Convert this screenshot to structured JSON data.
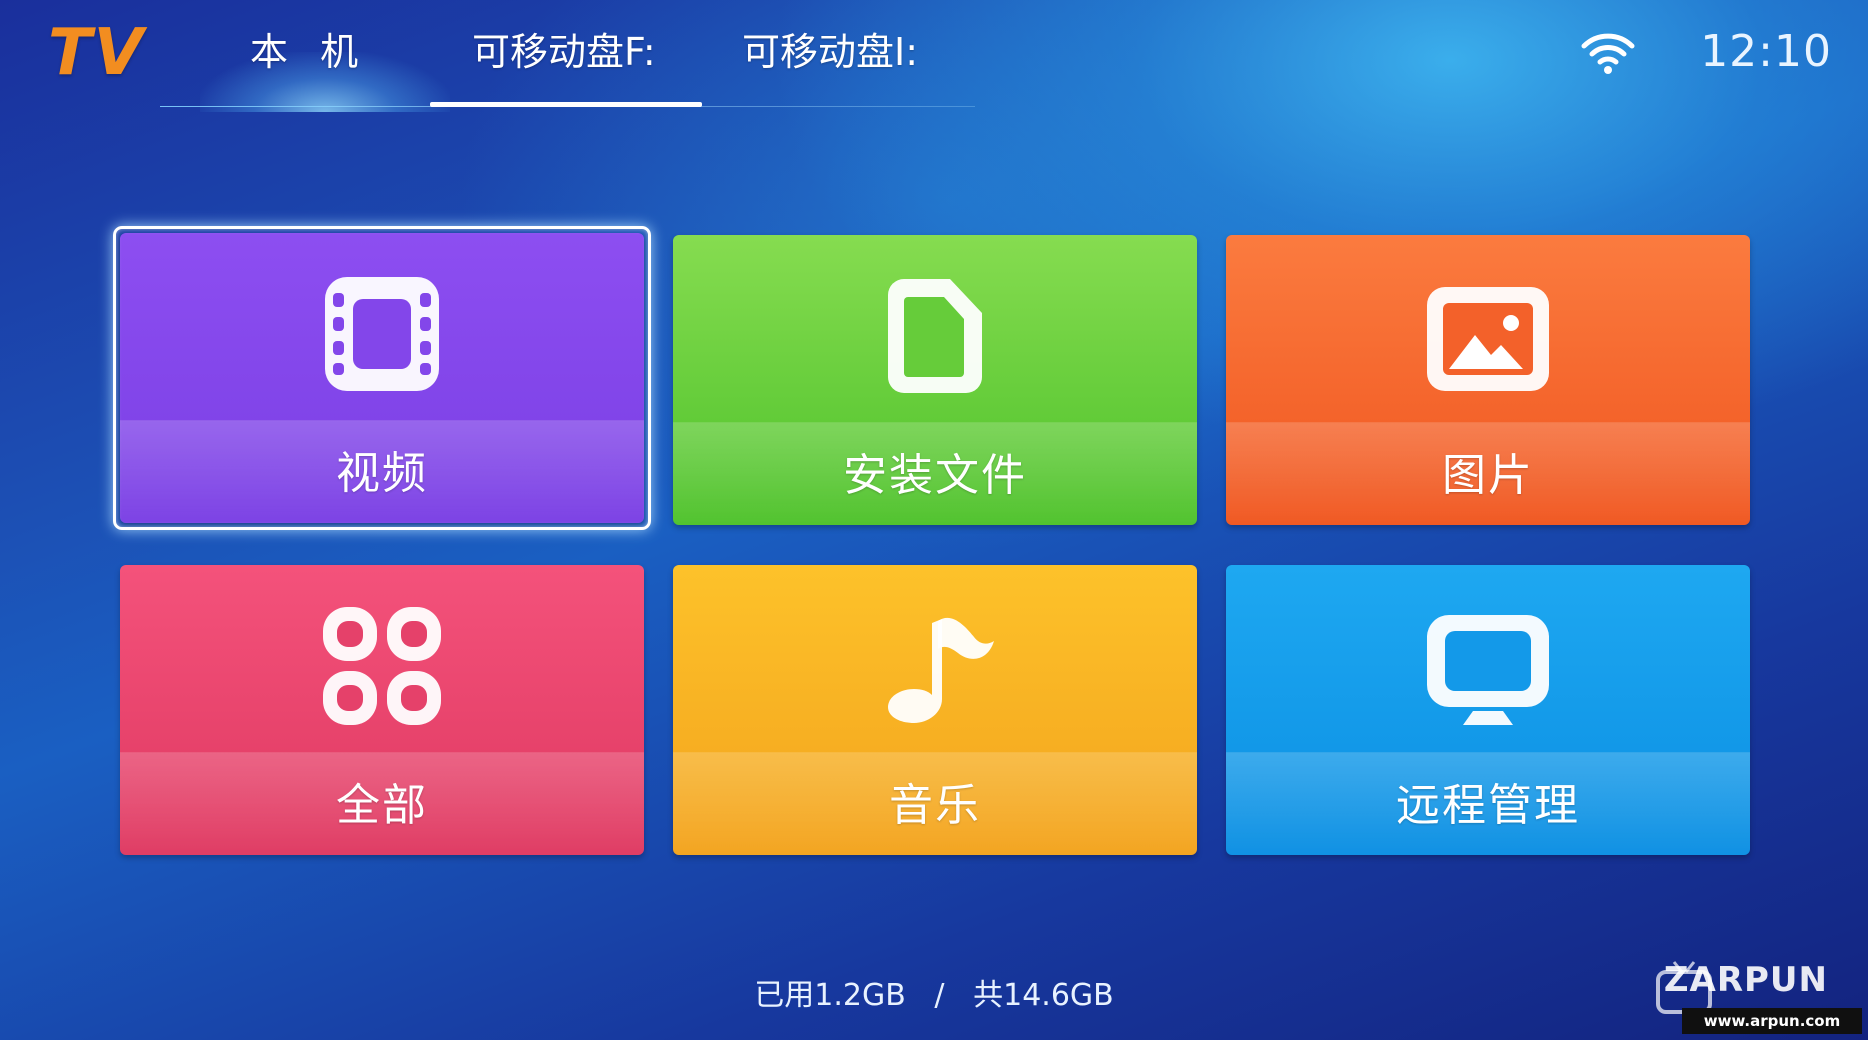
{
  "app": {
    "logo": "TV"
  },
  "tabs": [
    {
      "label": "本 机",
      "active": false
    },
    {
      "label": "可移动盘F:",
      "active": true
    },
    {
      "label": "可移动盘I:",
      "active": false
    }
  ],
  "status": {
    "wifi_icon": "wifi-icon",
    "time": "12:10"
  },
  "tiles": [
    {
      "label": "视频",
      "icon": "film-icon",
      "color": "#8d4ef1",
      "focused": true
    },
    {
      "label": "安装文件",
      "icon": "document-icon",
      "color": "#5cc832"
    },
    {
      "label": "图片",
      "icon": "image-icon",
      "color": "#f4602a"
    },
    {
      "label": "全部",
      "icon": "grid-icon",
      "color": "#e84468"
    },
    {
      "label": "音乐",
      "icon": "music-note-icon",
      "color": "#f8b221"
    },
    {
      "label": "远程管理",
      "icon": "monitor-icon",
      "color": "#129bea"
    }
  ],
  "storage": {
    "used": "已用1.2GB",
    "separator": "/",
    "total": "共14.6GB"
  },
  "watermark": {
    "brand": "ZARPUN",
    "url": "www.arpun.com"
  }
}
